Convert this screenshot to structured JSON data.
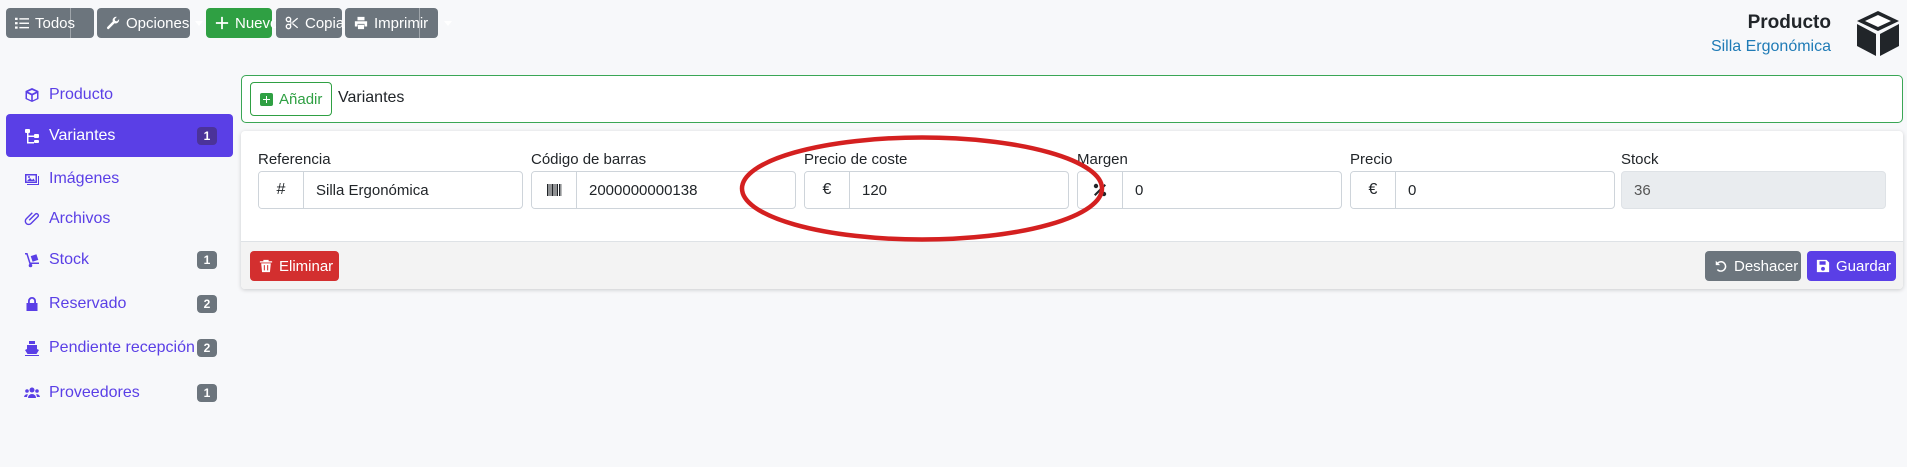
{
  "toolbar": {
    "todos_label": "Todos",
    "opciones_label": "Opciones",
    "nuevo_label": "Nuevo",
    "copiar_label": "Copiar",
    "imprimir_label": "Imprimir"
  },
  "header": {
    "title": "Producto",
    "subtitle": "Silla Ergonómica"
  },
  "sidebar": {
    "items": [
      {
        "label": "Producto",
        "icon": "cube-icon",
        "badge": ""
      },
      {
        "label": "Variantes",
        "icon": "sitemap-icon",
        "badge": "1",
        "active": true
      },
      {
        "label": "Imágenes",
        "icon": "images-icon",
        "badge": ""
      },
      {
        "label": "Archivos",
        "icon": "paperclip-icon",
        "badge": ""
      },
      {
        "label": "Stock",
        "icon": "dolly-icon",
        "badge": "1"
      },
      {
        "label": "Reservado",
        "icon": "lock-icon",
        "badge": "2"
      },
      {
        "label": "Pendiente recepción",
        "icon": "ship-icon",
        "badge": "2"
      },
      {
        "label": "Proveedores",
        "icon": "users-icon",
        "badge": "1"
      }
    ]
  },
  "variants": {
    "add_label": "Añadir",
    "title": "Variantes"
  },
  "form": {
    "referencia": {
      "label": "Referencia",
      "prefix": "#",
      "value": "Silla Ergonómica"
    },
    "codigo": {
      "label": "Código de barras",
      "value": "2000000000138"
    },
    "coste": {
      "label": "Precio de coste",
      "prefix": "€",
      "value": "120"
    },
    "margen": {
      "label": "Margen",
      "value": "0"
    },
    "precio": {
      "label": "Precio",
      "prefix": "€",
      "value": "0"
    },
    "stock": {
      "label": "Stock",
      "value": "36"
    }
  },
  "actions": {
    "eliminar_label": "Eliminar",
    "deshacer_label": "Deshacer",
    "guardar_label": "Guardar"
  },
  "colors": {
    "primary": "#5a3fe6",
    "success": "#2fa043",
    "danger": "#d32f2f",
    "secondary": "#6c757d",
    "annotation": "#d42020"
  }
}
